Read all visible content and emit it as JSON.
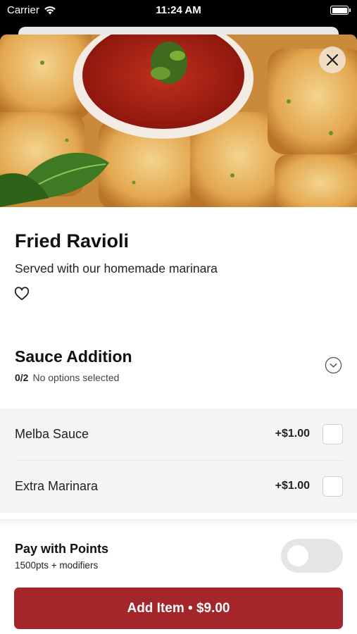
{
  "status_bar": {
    "carrier": "Carrier",
    "time": "11:24 AM"
  },
  "item": {
    "title": "Fried Ravioli",
    "description": "Served with our homemade marinara"
  },
  "modifier_group": {
    "title": "Sauce Addition",
    "count": "0/2",
    "status": "No options selected",
    "options": [
      {
        "label": "Melba Sauce",
        "price": "+$1.00",
        "checked": false
      },
      {
        "label": "Extra Marinara",
        "price": "+$1.00",
        "checked": false
      }
    ]
  },
  "points": {
    "title": "Pay with Points",
    "subtitle": "1500pts + modifiers",
    "enabled": false
  },
  "cta": {
    "label": "Add Item • $9.00"
  },
  "colors": {
    "accent": "#a4252a",
    "toggle_off": "#e5e5e5"
  },
  "icons": [
    "wifi-icon",
    "battery-icon",
    "close-icon",
    "heart-icon",
    "chevron-down-icon"
  ]
}
